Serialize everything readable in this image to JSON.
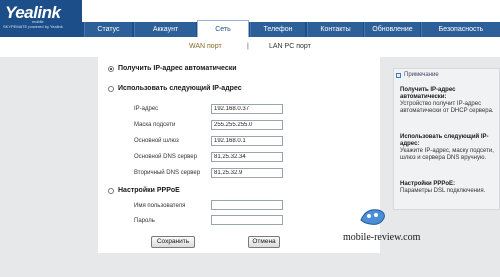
{
  "brand": {
    "logo": "Yealink",
    "sub_top": "mobile",
    "sub_bottom": "SKYPEMATE powered by Yealink"
  },
  "tabs": [
    {
      "label": "Статус",
      "active": false
    },
    {
      "label": "Аккаунт",
      "active": false
    },
    {
      "label": "Сеть",
      "active": true
    },
    {
      "label": "Телефон",
      "active": false
    },
    {
      "label": "Контакты",
      "active": false
    },
    {
      "label": "Обновление",
      "active": false
    },
    {
      "label": "Безопасность",
      "active": false
    }
  ],
  "subnav": {
    "wan": "WAN порт",
    "separator": "|",
    "lan": "LAN PC порт"
  },
  "form": {
    "dhcp_label": "Получить IP-адрес автоматически",
    "static_label": "Использовать следующий IP-адрес",
    "fields": [
      {
        "label": "IP-адрес",
        "value": "192.168.0.37"
      },
      {
        "label": "Маска подсети",
        "value": "255.255.255.0"
      },
      {
        "label": "Основной шлюз",
        "value": "192.168.0.1"
      },
      {
        "label": "Основной DNS сервер",
        "value": "81.25.32.34"
      },
      {
        "label": "Вторичный DNS сервер",
        "value": "81.25.32.9"
      }
    ],
    "pppoe_label": "Настройки PPPoE",
    "pppoe_fields": [
      {
        "label": "Имя пользователя",
        "value": ""
      },
      {
        "label": "Пароль",
        "value": ""
      }
    ],
    "save": "Сохранить",
    "cancel": "Отмена",
    "selected": "dhcp"
  },
  "note": {
    "header": "Примечание",
    "items": [
      {
        "title": "Получить IP-адрес автоматически:",
        "text": "Устройство получит IP-адрес автоматически от DHCP сервера."
      },
      {
        "title": "Использовать следующий IP-адрес:",
        "text": "Укажите IP-адрес, маску подсети, шлюз и сервера DNS вручную."
      },
      {
        "title": "Настройки PPPoE:",
        "text": "Параметры DSL подключения."
      }
    ]
  },
  "watermark": "mobile-review.com",
  "colors": {
    "brand_blue": "#1c4f89",
    "tab_blue": "#2d5f98",
    "panel_gray": "#e6e8ea"
  }
}
